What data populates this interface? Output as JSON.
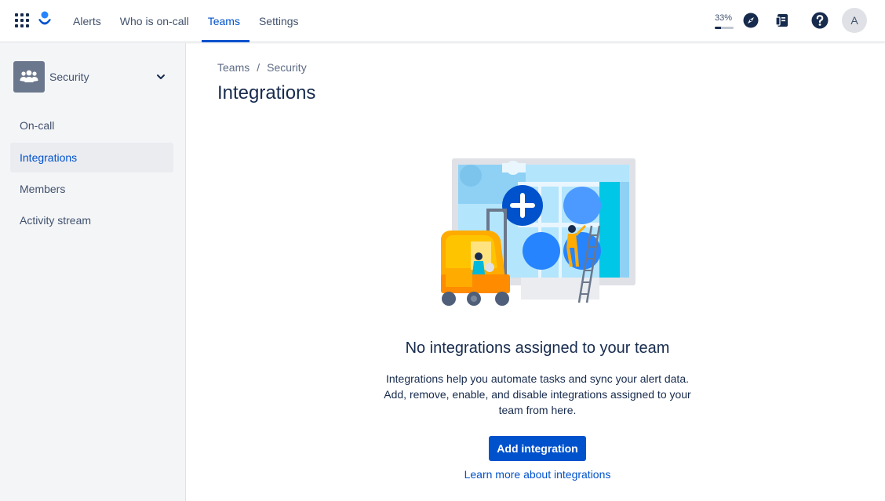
{
  "topnav": {
    "links": [
      {
        "label": "Alerts"
      },
      {
        "label": "Who is on-call"
      },
      {
        "label": "Teams",
        "active": true
      },
      {
        "label": "Settings"
      }
    ],
    "progress_label": "33%",
    "progress_value": 0.33,
    "icons": [
      "app-switcher-icon",
      "opsgenie-logo-icon",
      "compass-icon",
      "notebook-icon",
      "help-icon"
    ],
    "avatar_initial": "A"
  },
  "sidebar": {
    "team_name": "Security",
    "items": [
      {
        "label": "On-call"
      },
      {
        "label": "Integrations",
        "active": true
      },
      {
        "label": "Members"
      },
      {
        "label": "Activity stream"
      }
    ]
  },
  "main": {
    "breadcrumb": [
      "Teams",
      "Security"
    ],
    "breadcrumb_separator": "/",
    "title": "Integrations",
    "empty_state": {
      "title": "No integrations assigned to your team",
      "description": "Integrations help you automate tasks and sync your alert data. Add, remove, enable, and disable integrations assigned to your team from here.",
      "button_label": "Add integration",
      "link_label": "Learn more about integrations"
    }
  },
  "colors": {
    "brand": "#0052CC",
    "text": "#172B4D",
    "subtle_text": "#42526E",
    "sidebar_bg": "#F4F5F7"
  }
}
